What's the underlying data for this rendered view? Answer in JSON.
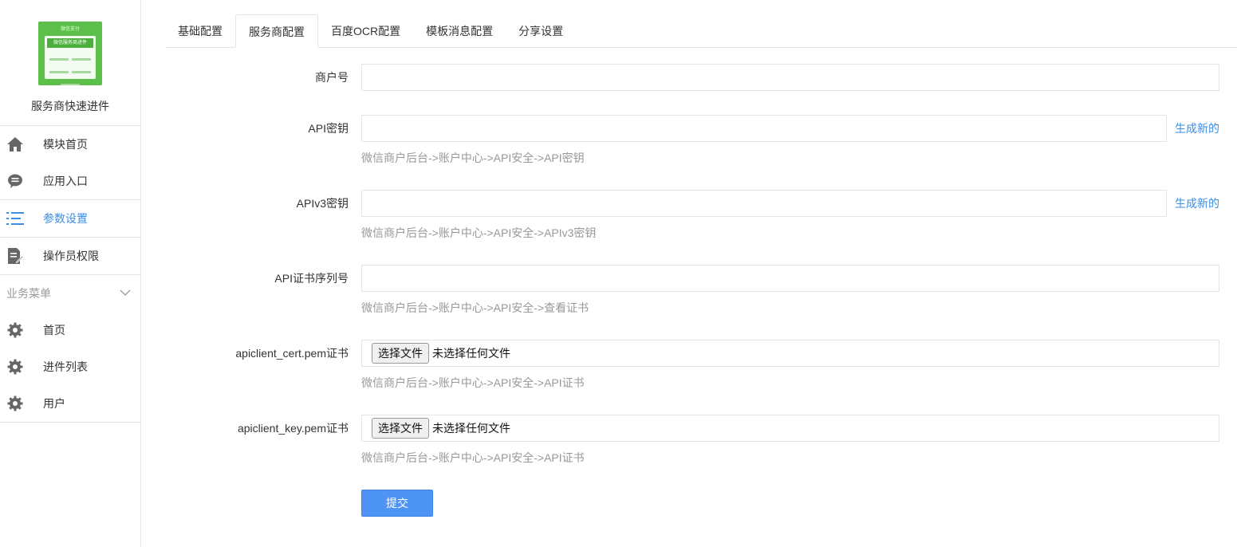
{
  "app": {
    "logo_top": "微信支付",
    "logo_banner": "微信服务商进件",
    "name": "服务商快速进件"
  },
  "menu": {
    "items": [
      {
        "label": "模块首页",
        "icon": "home-icon"
      },
      {
        "label": "应用入口",
        "icon": "chat-bubble-icon"
      },
      {
        "label": "参数设置",
        "icon": "list-settings-icon"
      },
      {
        "label": "操作员权限",
        "icon": "document-edit-icon"
      }
    ],
    "group_title": "业务菜单",
    "group_items": [
      {
        "label": "首页",
        "icon": "gear-icon"
      },
      {
        "label": "进件列表",
        "icon": "gear-icon"
      },
      {
        "label": "用户",
        "icon": "gear-icon"
      }
    ]
  },
  "tabs": [
    "基础配置",
    "服务商配置",
    "百度OCR配置",
    "模板消息配置",
    "分享设置"
  ],
  "active_tab": 1,
  "form": {
    "merchant_id": {
      "label": "商户号",
      "value": ""
    },
    "api_key": {
      "label": "API密钥",
      "value": "",
      "help": "微信商户后台->账户中心->API安全->API密钥",
      "action": "生成新的"
    },
    "apiv3_key": {
      "label": "APIv3密钥",
      "value": "",
      "help": "微信商户后台->账户中心->API安全->APIv3密钥",
      "action": "生成新的"
    },
    "cert_serial": {
      "label": "API证书序列号",
      "value": "",
      "help": "微信商户后台->账户中心->API安全->查看证书"
    },
    "cert_pem": {
      "label": "apiclient_cert.pem证书",
      "button": "选择文件",
      "status": "未选择任何文件",
      "help": "微信商户后台->账户中心->API安全->API证书"
    },
    "key_pem": {
      "label": "apiclient_key.pem证书",
      "button": "选择文件",
      "status": "未选择任何文件",
      "help": "微信商户后台->账户中心->API安全->API证书"
    },
    "submit": "提交"
  },
  "colors": {
    "accent": "#3a8ee6",
    "primary_button": "#4d94f4",
    "logo_green": "#5cbf4a"
  }
}
